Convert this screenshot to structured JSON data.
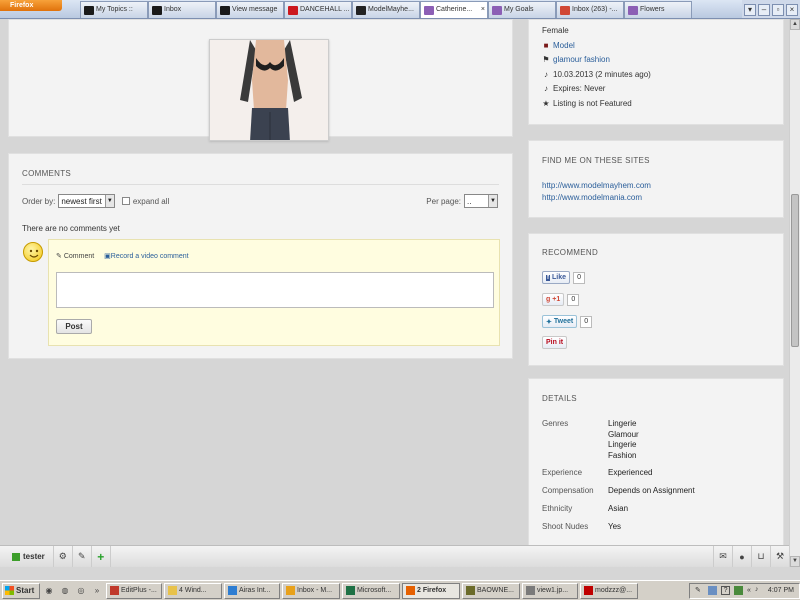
{
  "browser": {
    "firefox_button": "Firefox",
    "tabs": [
      {
        "label": "My Topics ::",
        "icon": "site-icon",
        "color": "#1a1a1a",
        "active": false
      },
      {
        "label": "Inbox",
        "icon": "site-icon",
        "color": "#1a1a1a",
        "active": false
      },
      {
        "label": "View message",
        "icon": "site-icon",
        "color": "#1a1a1a",
        "active": false
      },
      {
        "label": "DANCEHALL ...",
        "icon": "youtube-icon",
        "color": "#cc181e",
        "active": false
      },
      {
        "label": "ModelMayhe...",
        "icon": "modelmayhem-icon",
        "color": "#222222",
        "active": false
      },
      {
        "label": "Catherine...",
        "icon": "page-icon",
        "color": "#8c5fb5",
        "active": true
      },
      {
        "label": "My Goals",
        "icon": "page-icon",
        "color": "#8c5fb5",
        "active": false
      },
      {
        "label": "Inbox (263) -...",
        "icon": "gmail-icon",
        "color": "#d14836",
        "active": false
      },
      {
        "label": "Flowers",
        "icon": "page-icon",
        "color": "#8c5fb5",
        "active": false
      }
    ],
    "close_glyph": "×"
  },
  "listing_info": {
    "gender": "Female",
    "category": "Model",
    "tags": "glamour fashion",
    "posted": "10.03.2013 (2 minutes ago)",
    "expires": "Expires: Never",
    "featured": "Listing is not Featured"
  },
  "comments": {
    "title": "COMMENTS",
    "order_label": "Order by:",
    "order_value": "newest first",
    "expand_label": "expand all",
    "per_page_label": "Per page:",
    "per_page_value": "..",
    "empty_text": "There are no comments yet",
    "comment_tab": "Comment",
    "video_tab": "Record a video comment",
    "post_button": "Post"
  },
  "find_me": {
    "title": "FIND ME ON THESE SITES",
    "links": [
      "http://www.modelmayhem.com",
      "http://www.modelmania.com"
    ]
  },
  "recommend": {
    "title": "RECOMMEND",
    "like_label": "Like",
    "like_count": "0",
    "gplus_label": "+1",
    "gplus_count": "0",
    "tweet_label": "Tweet",
    "tweet_count": "0",
    "pin_label": "Pin it"
  },
  "details": {
    "title": "DETAILS",
    "rows": [
      {
        "key": "Genres",
        "value": [
          "Lingerie",
          "Glamour",
          "Lingerie",
          "Fashion"
        ]
      },
      {
        "key": "Experience",
        "value": [
          "Experienced"
        ]
      },
      {
        "key": "Compensation",
        "value": [
          "Depends on Assignment"
        ]
      },
      {
        "key": "Ethnicity",
        "value": [
          "Asian"
        ]
      },
      {
        "key": "Shoot Nudes",
        "value": [
          "Yes"
        ]
      }
    ]
  },
  "bottom_bar": {
    "username": "tester",
    "status_color": "#3c9e2a"
  },
  "taskbar": {
    "start_label": "Start",
    "tasks": [
      {
        "label": "EditPlus -...",
        "icon": "editplus-icon",
        "color": "#c0392b"
      },
      {
        "label": "4 Wind...",
        "icon": "folder-icon",
        "color": "#e8c24a"
      },
      {
        "label": "Airas Int...",
        "icon": "ie-icon",
        "color": "#2d7dd2"
      },
      {
        "label": "Inbox - M...",
        "icon": "mail-icon",
        "color": "#e8a11a"
      },
      {
        "label": "Microsoft...",
        "icon": "excel-icon",
        "color": "#1e7145"
      },
      {
        "label": "2 Firefox",
        "icon": "firefox-icon",
        "color": "#e66000",
        "active": true
      },
      {
        "label": "BAOWNE...",
        "icon": "app-icon",
        "color": "#6b6b2a"
      },
      {
        "label": "view1.jp...",
        "icon": "image-icon",
        "color": "#7a7a7a"
      },
      {
        "label": "modzzz@...",
        "icon": "filezilla-icon",
        "color": "#bf0000"
      }
    ],
    "clock": "4:07 PM"
  }
}
